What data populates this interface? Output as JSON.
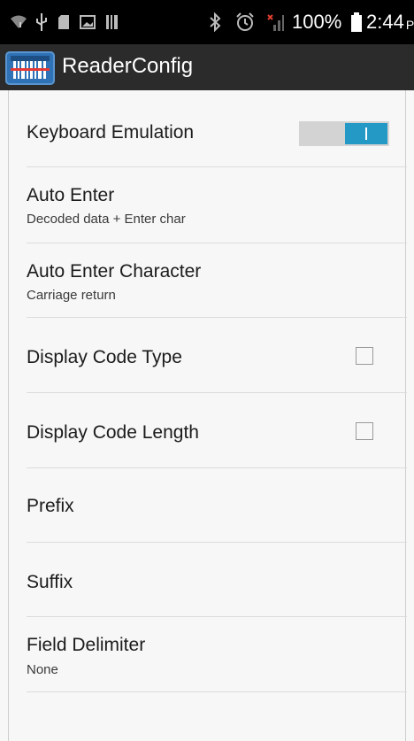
{
  "status_bar": {
    "icons": [
      "wifi-icon",
      "usb-icon",
      "sd-card-icon",
      "image-icon",
      "barcode-icon",
      "bluetooth-icon",
      "alarm-icon",
      "no-signal-icon"
    ],
    "battery_percent": "100%",
    "battery_icon": "battery-full-icon",
    "time": "2:44",
    "ampm": "PM"
  },
  "action_bar": {
    "app_icon": "barcode-reader-icon",
    "title": "ReaderConfig"
  },
  "settings": {
    "keyboard_emulation": {
      "title": "Keyboard Emulation",
      "enabled": true
    },
    "auto_enter": {
      "title": "Auto Enter",
      "summary": "Decoded data + Enter char"
    },
    "auto_enter_character": {
      "title": "Auto Enter Character",
      "summary": "Carriage return"
    },
    "display_code_type": {
      "title": "Display Code Type",
      "checked": false
    },
    "display_code_length": {
      "title": "Display Code Length",
      "checked": false
    },
    "prefix": {
      "title": "Prefix"
    },
    "suffix": {
      "title": "Suffix"
    },
    "field_delimiter": {
      "title": "Field Delimiter",
      "summary": "None"
    }
  },
  "colors": {
    "status_bar": "#000000",
    "action_bar": "#2b2b2b",
    "toggle_on": "#2599c6",
    "app_icon": "#2f72b5",
    "background": "#f7f7f7"
  }
}
